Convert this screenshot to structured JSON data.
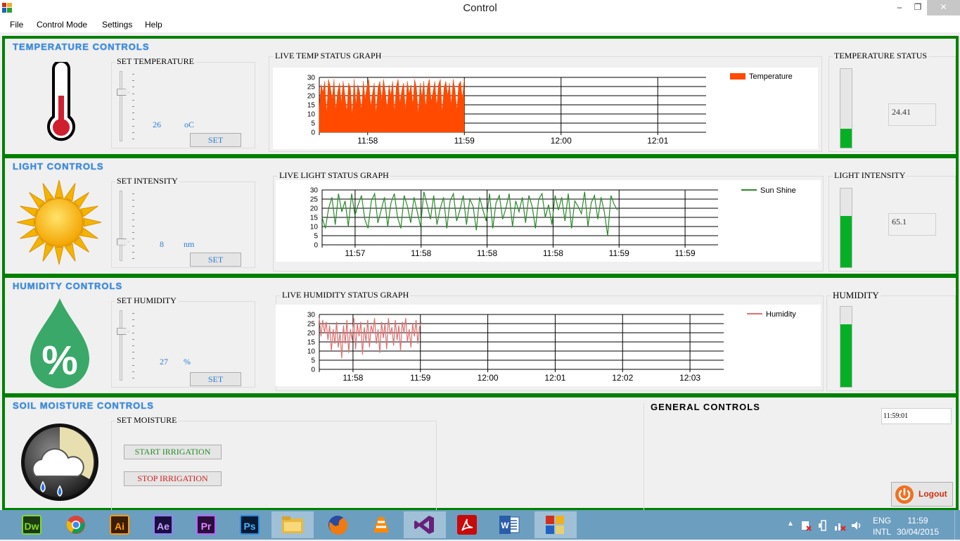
{
  "window": {
    "title": "Control",
    "min": "‒",
    "restore": "❐",
    "close": "✕"
  },
  "menu": [
    "File",
    "Control Mode",
    "Settings",
    "Help"
  ],
  "temperature": {
    "title": "TEMPERATURE CONTROLS",
    "set_label": "SET TEMPERATURE",
    "set_value": "26",
    "unit": "oC",
    "set_button": "SET",
    "graph_label": "LIVE TEMP STATUS GRAPH",
    "status_label": "TEMPERATURE STATUS",
    "status_value": "24.41",
    "status_level": 0.24,
    "slider_level": 0.72
  },
  "light": {
    "title": "LIGHT CONTROLS",
    "set_label": "SET INTENSITY",
    "set_value": "8",
    "unit": "nm",
    "set_button": "SET",
    "graph_label": "LIVE LIGHT STATUS GRAPH",
    "status_label": "LIGHT INTENSITY",
    "status_value": "65.1",
    "status_level": 0.65,
    "slider_level": 0.25
  },
  "humidity": {
    "title": "HUMIDITY CONTROLS",
    "set_label": "SET HUMIDITY",
    "set_value": "27",
    "unit": "%",
    "set_button": "SET",
    "graph_label": "LIVE HUMIDITY STATUS GRAPH",
    "status_label": "HUMIDITY",
    "status_level": 0.78,
    "slider_level": 0.72
  },
  "soil": {
    "title": "SOIL MOISTURE CONTROLS",
    "set_label": "SET MOISTURE",
    "start_button": "START IRRIGATION",
    "stop_button": "STOP IRRIGATION"
  },
  "general": {
    "title": "GENERAL CONTROLS",
    "time_value": "11:59:01",
    "logout_button": "Logout"
  },
  "taskbar": {
    "apps": [
      "Dw",
      "Chrome",
      "Ai",
      "Ae",
      "Pr",
      "Ps",
      "File Explorer",
      "Firefox",
      "VLC",
      "Visual Studio",
      "Acrobat",
      "Word",
      "Control"
    ],
    "labels": {
      "dw": "Dw",
      "ai": "Ai",
      "ae": "Ae",
      "pr": "Pr",
      "ps": "Ps"
    },
    "lang": "ENG",
    "layout": "INTL",
    "time": "11:59",
    "date": "30/04/2015"
  },
  "chart_data": [
    {
      "type": "area",
      "title": "",
      "y_ticks": [
        "0",
        "5",
        "10",
        "15",
        "20",
        "25",
        "30"
      ],
      "ylim": [
        0,
        30
      ],
      "x_ticks": [
        "11:58",
        "11:59",
        "12:00",
        "12:01"
      ],
      "series": [
        {
          "name": "Temperature",
          "color": "#ff4a00",
          "values": [
            14,
            26,
            22,
            28,
            10,
            29,
            25,
            18,
            29,
            12,
            22,
            27,
            16,
            28,
            20,
            11,
            27,
            24,
            9,
            29,
            15,
            26,
            22,
            12,
            28,
            18,
            25,
            29,
            14,
            21,
            27,
            10,
            24,
            28,
            17,
            29,
            22,
            13,
            26,
            20,
            28,
            11,
            25,
            29,
            16,
            23,
            27,
            12,
            28,
            21,
            26,
            15,
            29,
            24,
            10,
            27,
            19,
            28,
            13,
            25,
            29,
            17,
            22,
            28,
            14,
            26,
            29,
            11,
            24,
            28,
            20,
            27,
            15,
            29,
            23,
            12,
            26,
            28,
            18,
            29
          ]
        }
      ]
    },
    {
      "type": "line",
      "title": "",
      "y_ticks": [
        "0",
        "5",
        "10",
        "15",
        "20",
        "25",
        "30"
      ],
      "ylim": [
        0,
        30
      ],
      "x_ticks": [
        "11:57",
        "11:58",
        "11:58",
        "11:58",
        "11:59",
        "11:59"
      ],
      "series": [
        {
          "name": "Sun Shine",
          "color": "#2a8a2a",
          "values": [
            15,
            9,
            20,
            26,
            11,
            28,
            18,
            24,
            10,
            28,
            16,
            22,
            27,
            14,
            9,
            24,
            28,
            12,
            19,
            26,
            10,
            23,
            28,
            15,
            9,
            27,
            21,
            12,
            26,
            18,
            10,
            29,
            22,
            14,
            27,
            11,
            20,
            26,
            9,
            24,
            28,
            13,
            19,
            27,
            11,
            25,
            21,
            8,
            26,
            19,
            13,
            28,
            9,
            23,
            27,
            14,
            20,
            28,
            10,
            24,
            18,
            26,
            12,
            27,
            21,
            9,
            25,
            28,
            15,
            22,
            11,
            27,
            19,
            26,
            13,
            28,
            9,
            24,
            21,
            17,
            29,
            10,
            23,
            27,
            14,
            26,
            18,
            5,
            27,
            22,
            19
          ]
        }
      ]
    },
    {
      "type": "line",
      "title": "",
      "y_ticks": [
        "0",
        "5",
        "10",
        "15",
        "20",
        "25",
        "30"
      ],
      "ylim": [
        0,
        30
      ],
      "x_ticks": [
        "11:58",
        "11:59",
        "12:00",
        "12:01",
        "12:02",
        "12:03"
      ],
      "series": [
        {
          "name": "Humidity",
          "color": "#e07070",
          "values": [
            28,
            18,
            27,
            20,
            26,
            16,
            24,
            10,
            22,
            14,
            26,
            12,
            20,
            6,
            24,
            14,
            27,
            9,
            22,
            16,
            28,
            11,
            25,
            18,
            26,
            8,
            23,
            15,
            27,
            12,
            24,
            20,
            28,
            14,
            22,
            9,
            26,
            17,
            25,
            11,
            28,
            19,
            23,
            13,
            27,
            16,
            24,
            10,
            26,
            20,
            28,
            15,
            22,
            12,
            25,
            18,
            27,
            14,
            23,
            26
          ]
        }
      ]
    }
  ]
}
